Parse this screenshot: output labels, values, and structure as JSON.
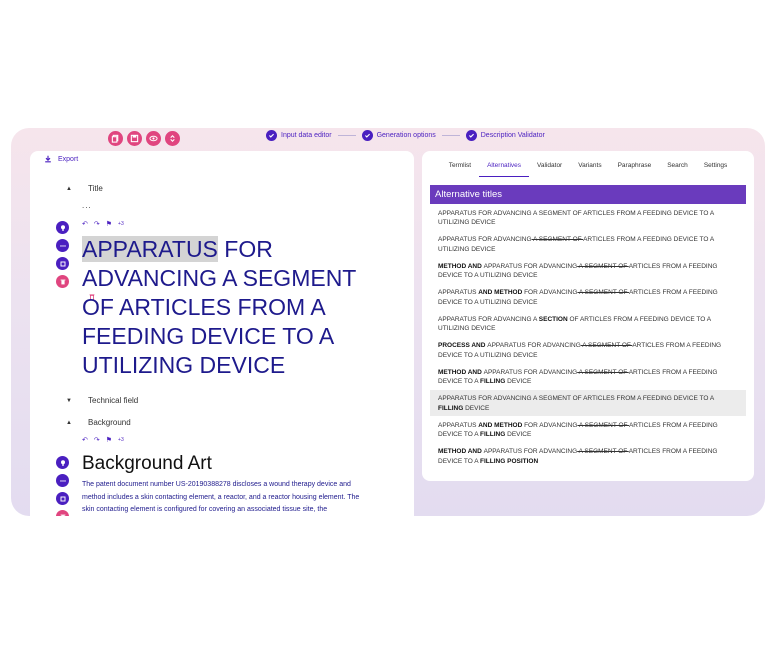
{
  "toolbar": {
    "icons": [
      "copy-icon",
      "save-icon",
      "eye-icon",
      "expand-icon"
    ],
    "accent": "#e0457f"
  },
  "stepper": {
    "steps": [
      "Input data editor",
      "Generation options",
      "Description Validator"
    ]
  },
  "editor": {
    "export_label": "Export",
    "title_section": "Title",
    "ellipsis": "...",
    "more_tools": "+3",
    "title_highlight": "APPARATUS",
    "title_rest": " FOR ADVANCING A SEGMENT OF ARTICLES FROM A FEEDING DEVICE TO A UTILIZING DEVICE",
    "technical_field": "Technical field",
    "background_section": "Background",
    "background_heading": "Background Art",
    "background_text": "The patent document number US-20190388278 discloses a wound therapy device and method includes a skin contacting element, a reactor, and a reactor housing element. The skin contacting element is configured for covering an associated tissue site, the"
  },
  "right_panel": {
    "tabs": [
      "Termlist",
      "Alternatives",
      "Validator",
      "Variants",
      "Paraphrase",
      "Search",
      "Settings"
    ],
    "active_tab": "Alternatives",
    "header": "Alternative titles",
    "header_color": "#6a3bbd",
    "alternatives": [
      [
        {
          "t": "APPARATUS FOR ADVANCING A SEGMENT OF ARTICLES FROM A FEEDING DEVICE TO A UTILIZING DEVICE",
          "s": "n"
        }
      ],
      [
        {
          "t": "APPARATUS FOR ADVANCING",
          "s": "n"
        },
        {
          "t": " A SEGMENT OF ",
          "s": "x"
        },
        {
          "t": "ARTICLES FROM A FEEDING DEVICE TO A UTILIZING DEVICE",
          "s": "n"
        }
      ],
      [
        {
          "t": "METHOD AND ",
          "s": "b"
        },
        {
          "t": "APPARATUS FOR ADVANCING",
          "s": "n"
        },
        {
          "t": " A SEGMENT OF ",
          "s": "x"
        },
        {
          "t": "ARTICLES FROM A FEEDING DEVICE TO A UTILIZING DEVICE",
          "s": "n"
        }
      ],
      [
        {
          "t": "APPARATUS ",
          "s": "n"
        },
        {
          "t": "AND METHOD ",
          "s": "b"
        },
        {
          "t": "FOR ADVANCING",
          "s": "n"
        },
        {
          "t": " A SEGMENT OF ",
          "s": "x"
        },
        {
          "t": "ARTICLES FROM A FEEDING DEVICE TO A UTILIZING DEVICE",
          "s": "n"
        }
      ],
      [
        {
          "t": "APPARATUS FOR ADVANCING A ",
          "s": "n"
        },
        {
          "t": "SECTION ",
          "s": "b"
        },
        {
          "t": "OF ARTICLES FROM A FEEDING DEVICE TO A UTILIZING DEVICE",
          "s": "n"
        }
      ],
      [
        {
          "t": "PROCESS AND ",
          "s": "b"
        },
        {
          "t": "APPARATUS FOR ADVANCING",
          "s": "n"
        },
        {
          "t": " A SEGMENT OF ",
          "s": "x"
        },
        {
          "t": "ARTICLES FROM A FEEDING DEVICE TO A UTILIZING DEVICE",
          "s": "n"
        }
      ],
      [
        {
          "t": "METHOD AND ",
          "s": "b"
        },
        {
          "t": "APPARATUS FOR ADVANCING",
          "s": "n"
        },
        {
          "t": " A SEGMENT OF ",
          "s": "x"
        },
        {
          "t": "ARTICLES FROM A FEEDING DEVICE TO A ",
          "s": "n"
        },
        {
          "t": "FILLING ",
          "s": "b"
        },
        {
          "t": "DEVICE",
          "s": "n"
        }
      ],
      [
        {
          "t": "APPARATUS FOR ADVANCING A SEGMENT OF ARTICLES FROM A FEEDING DEVICE TO A ",
          "s": "n"
        },
        {
          "t": "FILLING ",
          "s": "b"
        },
        {
          "t": "DEVICE",
          "s": "n"
        }
      ],
      [
        {
          "t": "APPARATUS ",
          "s": "n"
        },
        {
          "t": "AND METHOD ",
          "s": "b"
        },
        {
          "t": "FOR ADVANCING",
          "s": "n"
        },
        {
          "t": " A SEGMENT OF ",
          "s": "x"
        },
        {
          "t": "ARTICLES FROM A FEEDING DEVICE TO A ",
          "s": "n"
        },
        {
          "t": "FILLING ",
          "s": "b"
        },
        {
          "t": "DEVICE",
          "s": "n"
        }
      ],
      [
        {
          "t": "METHOD AND ",
          "s": "b"
        },
        {
          "t": "APPARATUS FOR ADVANCING",
          "s": "n"
        },
        {
          "t": " A SEGMENT OF ",
          "s": "x"
        },
        {
          "t": "ARTICLES FROM A FEEDING DEVICE TO A ",
          "s": "n"
        },
        {
          "t": "FILLING POSITION",
          "s": "b"
        },
        {
          "t": " ",
          "s": "n"
        }
      ]
    ],
    "selected_index": 7
  }
}
